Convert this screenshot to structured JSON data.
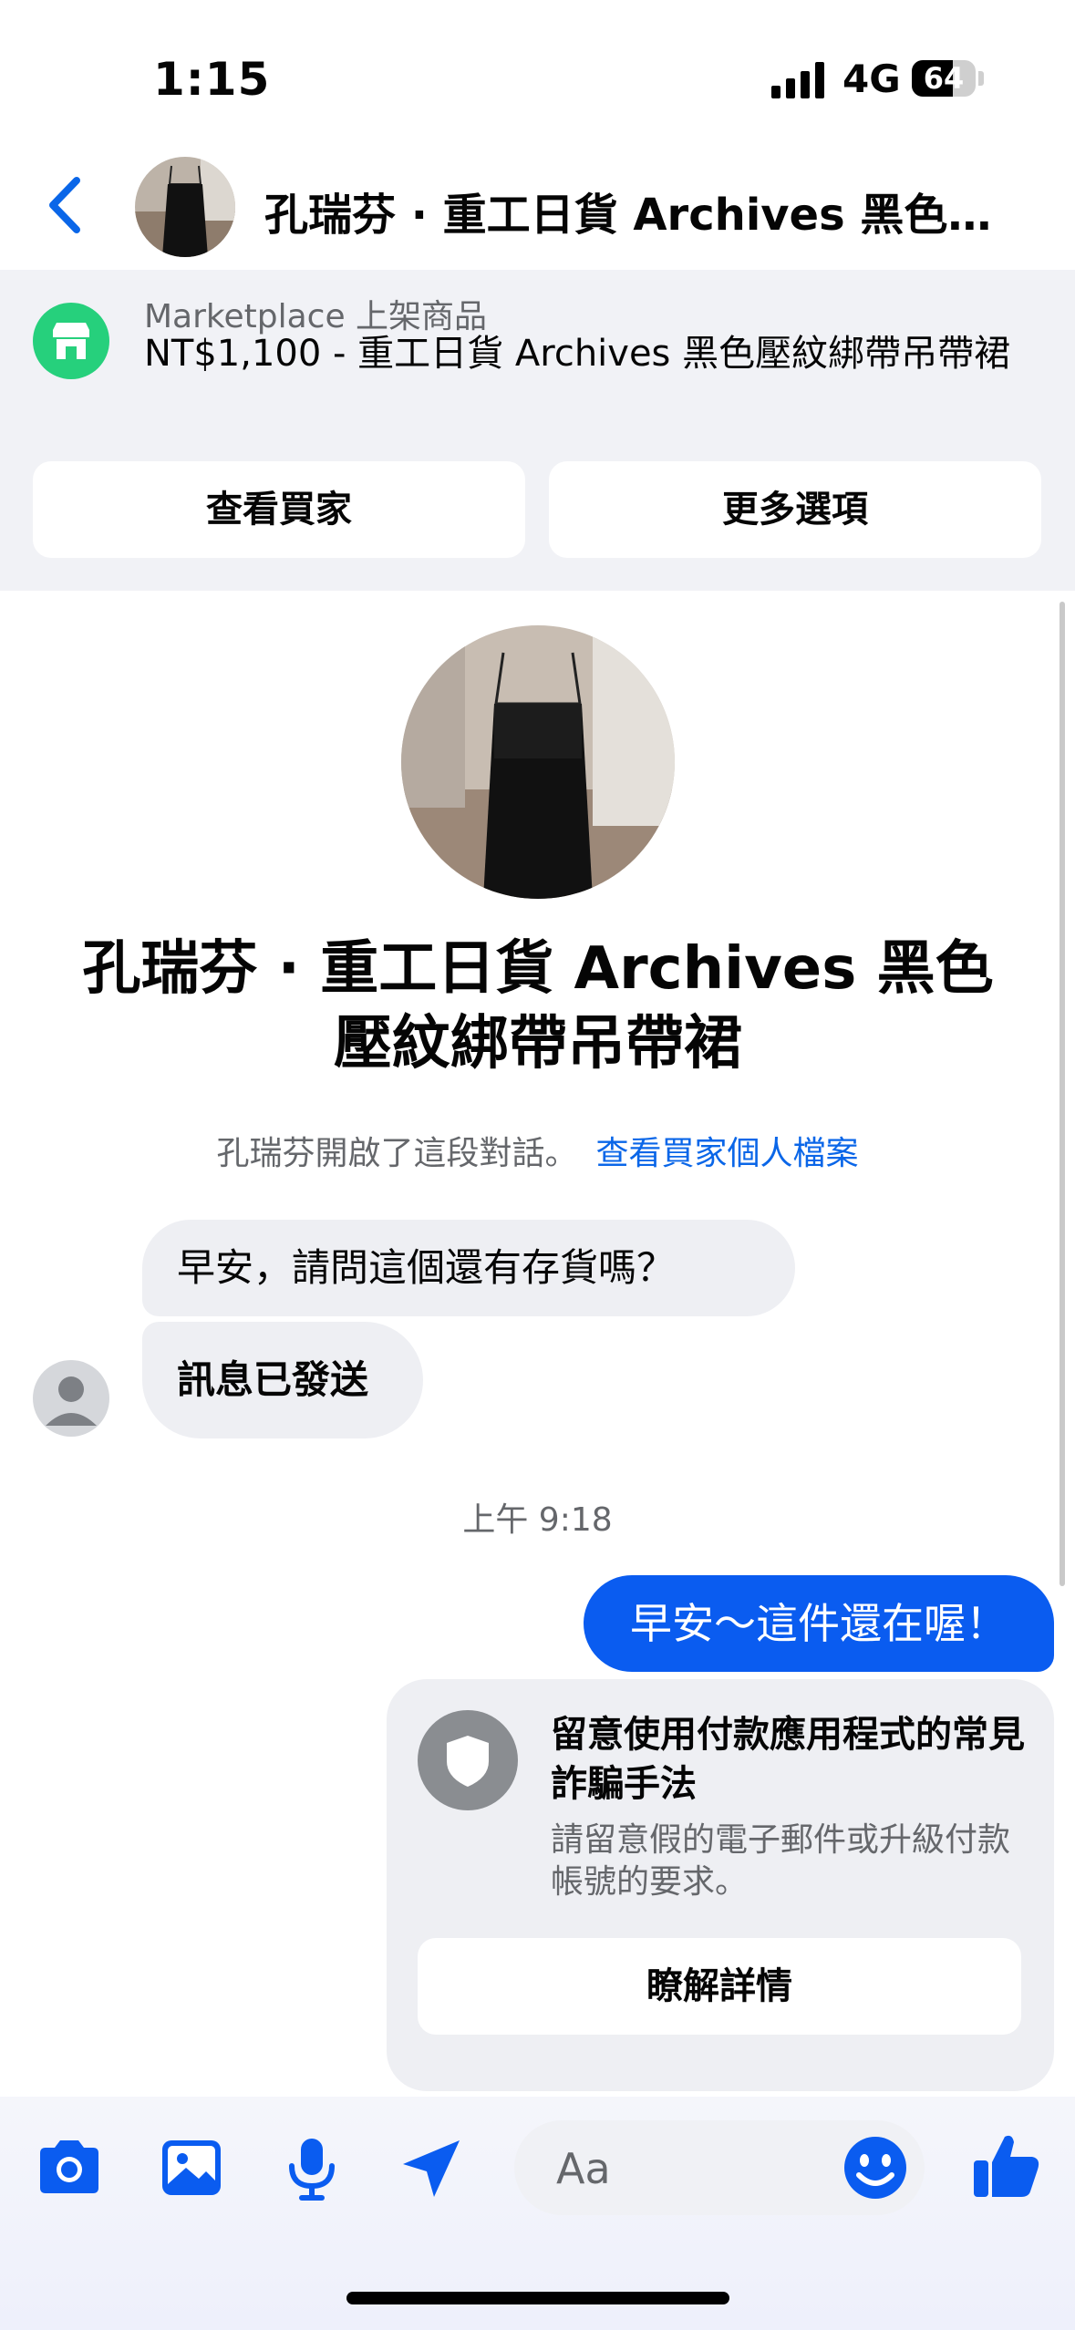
{
  "status_bar": {
    "time": "1:15",
    "network": "4G",
    "battery": "64",
    "battery_level": 0.64
  },
  "header": {
    "title": "孔瑞芬 · 重工日貨 Archives 黑色…"
  },
  "marketplace": {
    "label": "Marketplace 上架商品",
    "title": "NT$1,100 - 重工日貨 Archives 黑色壓紋綁帶吊帶裙",
    "view_buyer": "查看買家",
    "more_options": "更多選項"
  },
  "conversation": {
    "title": "孔瑞芬 · 重工日貨 Archives 黑色壓紋綁帶吊帶裙",
    "started_text": "孔瑞芬開啟了這段對話。",
    "view_profile": "查看買家個人檔案"
  },
  "messages": {
    "incoming_1": "早安，請問這個還有存貨嗎？",
    "incoming_2": "訊息已發送",
    "timestamp": "上午 9:18",
    "outgoing_1": "早安～這件還在喔！"
  },
  "safety_card": {
    "title": "留意使用付款應用程式的常見詐騙手法",
    "description": "請留意假的電子郵件或升級付款帳號的要求。",
    "button": "瞭解詳情"
  },
  "composer": {
    "placeholder": "Aa"
  },
  "colors": {
    "accent": "#0a5cf0",
    "marketplace_green": "#26d07c"
  },
  "icons": [
    "back-arrow-icon",
    "storefront-icon",
    "shield-icon",
    "camera-icon",
    "photo-icon",
    "microphone-icon",
    "send-icon",
    "emoji-icon",
    "thumbs-up-icon"
  ]
}
